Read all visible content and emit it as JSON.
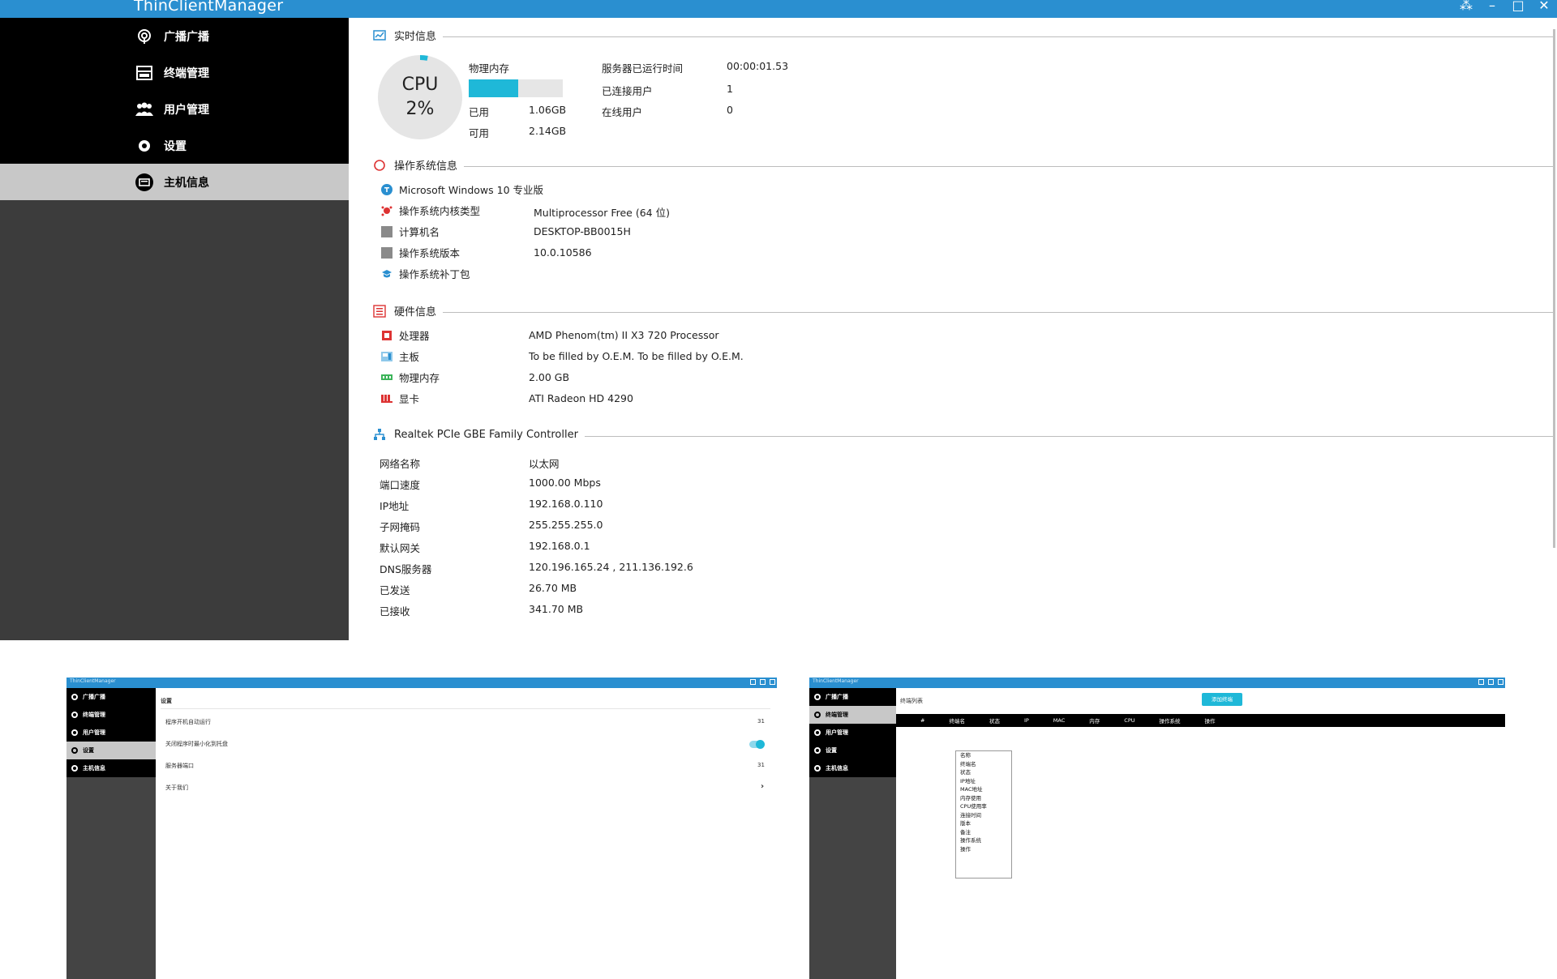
{
  "app": {
    "title": "ThinClientManager",
    "controls": [
      "⁂",
      "–",
      "□",
      "✕"
    ]
  },
  "sidebar": {
    "items": [
      {
        "label": "广播广播",
        "icon": "broadcast-icon"
      },
      {
        "label": "终端管理",
        "icon": "terminal-icon"
      },
      {
        "label": "用户管理",
        "icon": "users-icon"
      },
      {
        "label": "设置",
        "icon": "settings-icon"
      },
      {
        "label": "主机信息",
        "icon": "host-info-icon"
      }
    ],
    "active_index": 4
  },
  "realtime": {
    "title": "实时信息",
    "cpu_label": "CPU",
    "cpu_percent": "2%",
    "cpu_value": 2,
    "memory_label": "物理内存",
    "memory_used_fraction": 0.53,
    "used_label": "已用",
    "used_value": "1.06GB",
    "avail_label": "可用",
    "avail_value": "2.14GB",
    "uptime_label": "服务器已运行时间",
    "uptime_value": "00:00:01.53",
    "connected_label": "已连接用户",
    "connected_value": "1",
    "online_label": "在线用户",
    "online_value": "0"
  },
  "os": {
    "title": "操作系统信息",
    "name": "Microsoft Windows 10 专业版",
    "rows": [
      {
        "label": "操作系统内核类型",
        "value": "Multiprocessor Free (64 位)"
      },
      {
        "label": "计算机名",
        "value": "DESKTOP-BB0015H"
      },
      {
        "label": "操作系统版本",
        "value": "10.0.10586"
      },
      {
        "label": "操作系统补丁包",
        "value": ""
      }
    ]
  },
  "hardware": {
    "title": "硬件信息",
    "rows": [
      {
        "label": "处理器",
        "value": "AMD Phenom(tm) II X3 720 Processor"
      },
      {
        "label": "主板",
        "value": "To be filled by O.E.M. To be filled by O.E.M."
      },
      {
        "label": "物理内存",
        "value": "2.00 GB"
      },
      {
        "label": "显卡",
        "value": "ATI Radeon HD 4290"
      }
    ]
  },
  "network": {
    "title": "Realtek PCIe GBE Family Controller",
    "rows": [
      {
        "label": "网络名称",
        "value": "以太网"
      },
      {
        "label": "端口速度",
        "value": "1000.00 Mbps"
      },
      {
        "label": "IP地址",
        "value": "192.168.0.110"
      },
      {
        "label": "子网掩码",
        "value": "255.255.255.0"
      },
      {
        "label": "默认网关",
        "value": "192.168.0.1"
      },
      {
        "label": "DNS服务器",
        "value": "120.196.165.24 , 211.136.192.6"
      },
      {
        "label": "已发送",
        "value": "26.70 MB"
      },
      {
        "label": "已接收",
        "value": "341.70 MB"
      }
    ]
  },
  "thumb_settings": {
    "title": "ThinClientManager",
    "nav": [
      "广播广播",
      "终端管理",
      "用户管理",
      "设置",
      "主机信息"
    ],
    "active_index": 3,
    "heading": "设置",
    "rows": [
      "程序开机自动运行",
      "关闭程序时最小化到托盘",
      "服务器端口",
      "关于我们"
    ],
    "values": [
      "31",
      "",
      "31",
      "›"
    ]
  },
  "thumb_terminals": {
    "title": "ThinClientManager",
    "nav": [
      "广播广播",
      "终端管理",
      "用户管理",
      "设置",
      "主机信息"
    ],
    "active_index": 1,
    "heading": "终端列表",
    "button": "添加终端",
    "columns": [
      "#",
      "终端名",
      "状态",
      "IP",
      "MAC",
      "内存",
      "CPU",
      "操作系统",
      "操作"
    ],
    "dropdown": [
      "名称",
      "终端名",
      "状态",
      "IP地址",
      "MAC地址",
      "内存使用",
      "CPU使用率",
      "连接时间",
      "版本",
      "备注",
      "操作系统",
      "操作"
    ]
  },
  "colors": {
    "titlebar": "#2a8fd0",
    "accent": "#1fb8d8",
    "sidebar_nav": "#000000",
    "sidebar_active": "#c8c8c8",
    "sidebar_body": "#3c3c3c"
  }
}
